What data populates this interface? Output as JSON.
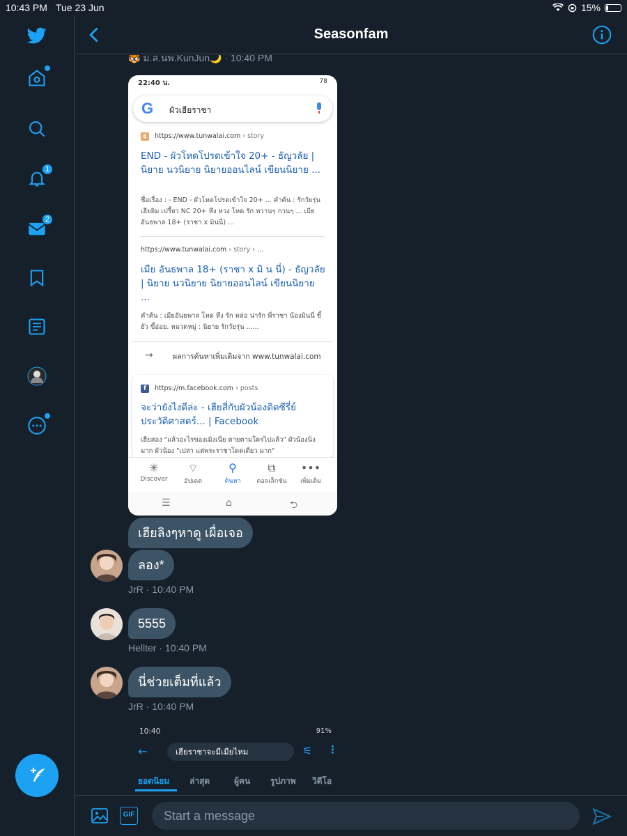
{
  "status_bar": {
    "time": "10:43 PM",
    "date": "Tue 23 Jun",
    "battery": "15%"
  },
  "sidebar": {
    "notifications_badge": "1",
    "messages_badge": "2"
  },
  "header": {
    "title": "Seasonfam"
  },
  "conversation": {
    "top_meta": "🐯 ม.ล.นพ.KunJun🌙 · 10:40 PM",
    "screenshot1": {
      "status_time": "22:40 น.",
      "status_right": "78",
      "search_query": "ผัวเฮียราชา",
      "results": [
        {
          "url": "https://www.tunwalai.com",
          "url_path": "› story",
          "title": "END - ผัวโหดโปรดเข้าใจ 20+ - ธัญวลัย | นิยาย นวนิยาย นิยายออนไลน์ เขียนนิยาย ...",
          "snippet": "ชื่อเรื่อง : - END - ผัวโหดโปรดเข้าใจ 20+ ... คำค้น : รักวัยรุ่น เฮียยิม เปรี้ยว NC 20+ หึง หวง โหด รัก หวานๆ กวนๆ ... เมียอันธพาล 18+ (ราชา x มินนี่) ..."
        },
        {
          "url": "https://www.tunwalai.com",
          "url_path": "› story › ...",
          "title": "เมีย อันธพาล 18+ (ราชา x มิ น นี่) - ธัญวลัย | นิยาย นวนิยาย นิยายออนไลน์ เขียนนิยาย ...",
          "snippet": "คำค้น : เมียอันธพาล โหด หึง รัก หล่อ น่ารัก พี่ราชา น้องมินนี่ ขี้ยั่ว ขี้อ่อย. หมวดหมู่ : นิยาย รักวัยรุ่น ......"
        }
      ],
      "more_results": "ผลการค้นหาเพิ่มเติมจาก www.tunwalai.com",
      "fb_result": {
        "url": "https://m.facebook.com",
        "url_path": "› posts",
        "title": "จะว่ายังไงดีล่ะ - เฮียสี่กับผัวน้องติดซีรี่ย์ ประวัติศาสตร์... | Facebook",
        "snippet": "เฮียสอง \"แล้วอะไรของเมิงเนี่ย ตายตามใครไปแล้ว\" ผัวน้องนิ่งมาก ผัวน้อง \"เปล่า แต่พระราชาโดดเดี่ยว มาก\""
      },
      "nav": [
        "Discover",
        "อัปเดต",
        "ค้นหา",
        "คอลเล็กชัน",
        "เพิ่มเติม"
      ]
    },
    "messages": [
      {
        "text": "เฮียลิงๆหาดู เผื่อเจอ"
      },
      {
        "text": "ลอง*",
        "sender": "JrR",
        "time": "10:40 PM"
      },
      {
        "text": "5555",
        "sender": "Hellter",
        "time": "10:40 PM"
      },
      {
        "text": "นี่ช่วยเต็มที่แล้ว",
        "sender": "JrR",
        "time": "10:40 PM"
      }
    ],
    "screenshot2": {
      "status_time": "10:40",
      "status_right": "91%",
      "search_query": "เฮียราชาจะมีเมียไหม",
      "tabs": [
        "ยอดนิยม",
        "ล่าสุด",
        "ผู้คน",
        "รูปภาพ",
        "วิดีโอ"
      ]
    }
  },
  "composer": {
    "placeholder": "Start a message",
    "gif_label": "GIF"
  },
  "colors": {
    "background": "#15202b",
    "accent": "#1da1f2",
    "bubble": "#3d5466",
    "border": "#38444d"
  }
}
